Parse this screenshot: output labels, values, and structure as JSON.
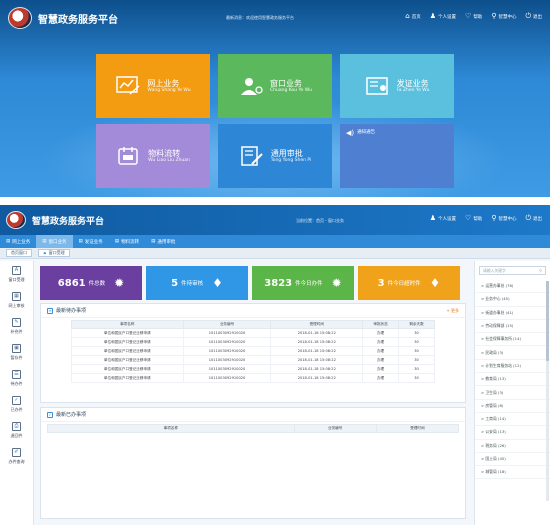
{
  "portal": {
    "app_title": "智慧政务服务平台",
    "top_note": "最新消息：欢迎使用智慧政务服务平台",
    "nav": [
      {
        "label": "首页",
        "icon": "home-icon"
      },
      {
        "label": "个人设置",
        "icon": "user-icon"
      },
      {
        "label": "帮助",
        "icon": "help-icon"
      },
      {
        "label": "智慧中心",
        "icon": "search-icon"
      },
      {
        "label": "退出",
        "icon": "power-icon"
      }
    ],
    "tiles": [
      {
        "name": "网上业务",
        "pinyin": "Wang Shang Ye Wu",
        "color": "#f39c12"
      },
      {
        "name": "窗口业务",
        "pinyin": "Chuang Kou Ye Wu",
        "color": "#5cb85c"
      },
      {
        "name": "发证业务",
        "pinyin": "Fa Zhen Ye Wu",
        "color": "#5bc0de"
      },
      {
        "name": "物料流转",
        "pinyin": "Wu Liao Liu Zhuan",
        "color": "#a38bd9"
      },
      {
        "name": "通用审批",
        "pinyin": "Tong Yong Shen Pi",
        "color": "#2e86d6"
      },
      {
        "name": "通知通告",
        "pinyin": "",
        "color": "#4f7fd1"
      }
    ]
  },
  "workbench": {
    "app_title": "智慧政务服务平台",
    "top_note": "当前位置：首页 - 窗口业务",
    "nav": [
      {
        "label": "个人设置",
        "icon": "user-icon"
      },
      {
        "label": "帮助",
        "icon": "help-icon"
      },
      {
        "label": "智慧中心",
        "icon": "search-icon"
      },
      {
        "label": "退出",
        "icon": "power-icon"
      }
    ],
    "tabs": [
      "网上业务",
      "窗口业务",
      "发证业务",
      "物料流转",
      "通用审批"
    ],
    "crumbs": [
      "首页窗口",
      "窗口受理"
    ],
    "sidebar": [
      {
        "label": "窗口受理",
        "icon": "A"
      },
      {
        "label": "网上审核",
        "icon": "▦"
      },
      {
        "label": "补充件",
        "icon": "✎"
      },
      {
        "label": "暂存件",
        "icon": "▣"
      },
      {
        "label": "待办件",
        "icon": "☰"
      },
      {
        "label": "已办件",
        "icon": "✓"
      },
      {
        "label": "退回件",
        "icon": "⎙"
      },
      {
        "label": "办件查询",
        "icon": "✐"
      }
    ],
    "stats": [
      {
        "num": "6861",
        "label": "件总数",
        "color": "#6b3fa0",
        "icon": "✹"
      },
      {
        "num": "5",
        "label": "件待审核",
        "color": "#2f97e6",
        "icon": "♦"
      },
      {
        "num": "3823",
        "label": "件今日办件",
        "color": "#5bb548",
        "icon": "✹"
      },
      {
        "num": "3",
        "label": "件今日超时件",
        "color": "#f0a21a",
        "icon": "♦"
      }
    ],
    "panel1_title": "最新待办事项",
    "more_label": "更多",
    "table_headers": [
      "事项名称",
      "业务编号",
      "受理时间",
      "审批状态",
      "剩余天数"
    ],
    "rows": [
      [
        "单位和居民户口登记迁移申请",
        "1011003092910020",
        "2018-01-18 15:08:22",
        "办理",
        "30"
      ],
      [
        "单位和居民户口登记迁移申请",
        "1011003092910020",
        "2018-01-18 15:08:22",
        "办理",
        "30"
      ],
      [
        "单位和居民户口登记迁移申请",
        "1011003092910020",
        "2018-01-18 15:08:22",
        "办理",
        "30"
      ],
      [
        "单位和居民户口登记迁移申请",
        "1011003092910020",
        "2018-01-18 15:08:22",
        "办理",
        "30"
      ],
      [
        "单位和居民户口登记迁移申请",
        "1011003092910020",
        "2018-01-18 15:08:22",
        "办理",
        "30"
      ],
      [
        "单位和居民户口登记迁移申请",
        "1011003092910020",
        "2018-01-18 15:08:22",
        "办理",
        "30"
      ]
    ],
    "panel2_title": "最新已办事项",
    "panel2_headers": [
      "事项名称",
      "业务编号",
      "受理时间"
    ],
    "search_placeholder": "请输入关键字",
    "right_items": [
      "> 运营办事处 (76)",
      "> 业务中心 (45)",
      "> 街道办事处 (41)",
      "> 劳动保障部 (15)",
      "> 社会保障事务所 (14)",
      "> 民政局 (3)",
      "> 计划生育服务站 (12)",
      "> 教育局 (13)",
      "> 卫生局 (3)",
      "> 房管局 (8)",
      "> 工商局 (14)",
      "> 公安局 (13)",
      "> 税务局 (26)",
      "> 国土局 (45)",
      "> 城管局 (18)"
    ]
  }
}
